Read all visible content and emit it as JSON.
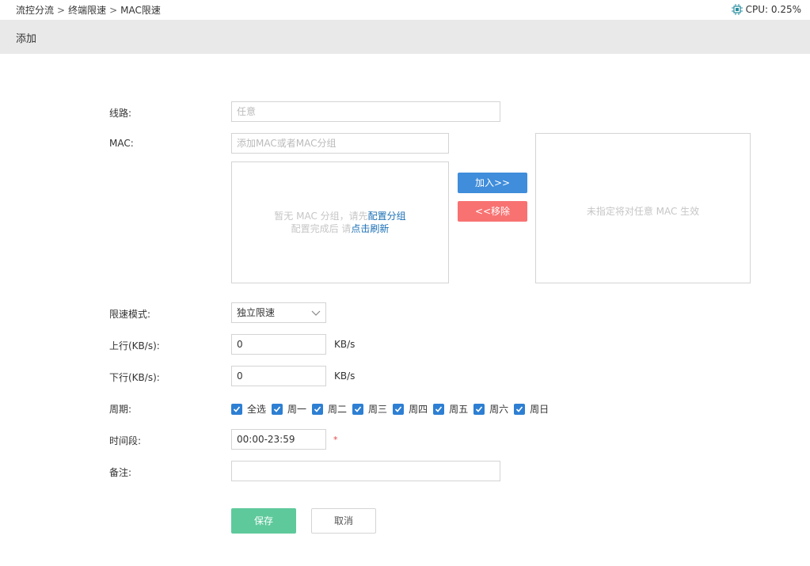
{
  "breadcrumb": [
    "流控分流",
    "终端限速",
    "MAC限速"
  ],
  "cpu": {
    "label": "CPU: 0.25%"
  },
  "page_title": "添加",
  "form": {
    "line": {
      "label": "线路:",
      "placeholder": "任意"
    },
    "mac": {
      "label": "MAC:",
      "placeholder": "添加MAC或者MAC分组",
      "empty_msg_1": "暂无 MAC 分组，请先",
      "config_group_link": "配置分组",
      "empty_msg_2": "配置完成后 请",
      "refresh_link": "点击刷新",
      "add_button": "加入>>",
      "remove_button": "<<移除",
      "selected_empty_msg": "未指定将对任意 MAC 生效"
    },
    "limit_mode": {
      "label": "限速模式:",
      "value": "独立限速"
    },
    "upload": {
      "label": "上行(KB/s):",
      "value": "0",
      "unit": "KB/s"
    },
    "download": {
      "label": "下行(KB/s):",
      "value": "0",
      "unit": "KB/s"
    },
    "period": {
      "label": "周期:",
      "options": [
        {
          "label": "全选",
          "checked": true
        },
        {
          "label": "周一",
          "checked": true
        },
        {
          "label": "周二",
          "checked": true
        },
        {
          "label": "周三",
          "checked": true
        },
        {
          "label": "周四",
          "checked": true
        },
        {
          "label": "周五",
          "checked": true
        },
        {
          "label": "周六",
          "checked": true
        },
        {
          "label": "周日",
          "checked": true
        }
      ]
    },
    "time_range": {
      "label": "时间段:",
      "value": "00:00-23:59",
      "required_mark": "*"
    },
    "note": {
      "label": "备注:",
      "value": ""
    }
  },
  "actions": {
    "save": "保存",
    "cancel": "取消"
  },
  "colors": {
    "primary": "#3f8ddb",
    "danger": "#f87272",
    "success": "#5ec99b",
    "checkbox": "#2d7fd3"
  }
}
